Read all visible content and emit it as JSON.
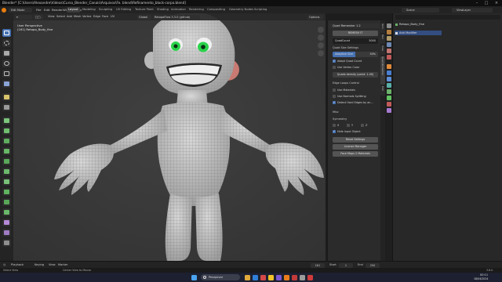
{
  "window": {
    "title": "Blender* [C:\\Users\\Alexandre\\Videos\\Curso_Blender_Canais\\Arquivos\\Fe. blend\\Refinamento_block-corpo.blend]"
  },
  "menubar": {
    "editor_mode": "Edit Mode",
    "menus": [
      "File",
      "Edit",
      "Render",
      "Window",
      "Help"
    ],
    "workspaces": [
      "Layout",
      "Modeling",
      "Sculpting",
      "UV Editing",
      "Texture Paint",
      "Shading",
      "Animation",
      "Rendering",
      "Compositing",
      "Geometry Nodes",
      "Scripting"
    ],
    "active_workspace": "Layout",
    "scene_label": "Scene",
    "view_layer_label": "ViewLayer"
  },
  "viewport_header": {
    "items": [
      "View",
      "Select",
      "Add",
      "Mesh",
      "Vertex",
      "Edge",
      "Face",
      "UV"
    ],
    "transform": "Global",
    "addon_label": "RetopoFlow 3.3.0 (github)",
    "options_label": "Options"
  },
  "viewport": {
    "view_name": "User Perspective",
    "object_info": "(161) Retopo_Body_fine"
  },
  "npanel": {
    "panel_title": "Quad Remesher 1.2",
    "remesh_button": "REMESH IT",
    "quad_count_label": "QuadCount",
    "quad_count_value": "5000",
    "quad_size_header": "Quad Size Settings",
    "adaptive_label": "Adaptive Size",
    "adaptive_value": "50%",
    "adapt_quad_count": "Adapt Quad Count",
    "use_vertex_color": "Use Vertex Color",
    "quads_density_label": "Quads density (paint: 1.00)",
    "edge_loops_header": "Edge Loops Control",
    "use_materials": "Use Materials",
    "use_normals_splitting": "Use Normals Splitting",
    "detect_hard_edges": "Detect Hard Edges by an...",
    "misc_header": "Misc",
    "symmetry_label": "Symmetry",
    "sym_x": "X",
    "sym_y": "Y",
    "sym_z": "Z",
    "hide_input_object": "Hide Input Object",
    "reset_settings": "Reset Settings",
    "license_manager": "License Manager",
    "face_maps_materials": "Face Maps 2 Materials",
    "vertical_tabs": [
      "Item",
      "Tool",
      "View",
      "Quad Remesher",
      "Edit"
    ]
  },
  "outliner": {
    "search_placeholder": "",
    "rows": [
      "Retopo_Body_fine",
      "Add Modifier"
    ]
  },
  "timeline": {
    "playback": "Playback",
    "keying": "Keying",
    "view": "View",
    "marker": "Marker",
    "current_frame": "161",
    "start_label": "Start",
    "start": "1",
    "end_label": "End",
    "end": "250"
  },
  "statusbar": {
    "left": "Select View",
    "middle": "Center View to Mouse",
    "right": "3.6.0"
  },
  "taskbar": {
    "search_label": "Pesquisar",
    "time": "00:11",
    "date": "18/04/2024"
  },
  "colors": {
    "accent": "#4772b3",
    "viewport_bg": "#393939",
    "character_eyes": "#2bd14a"
  }
}
